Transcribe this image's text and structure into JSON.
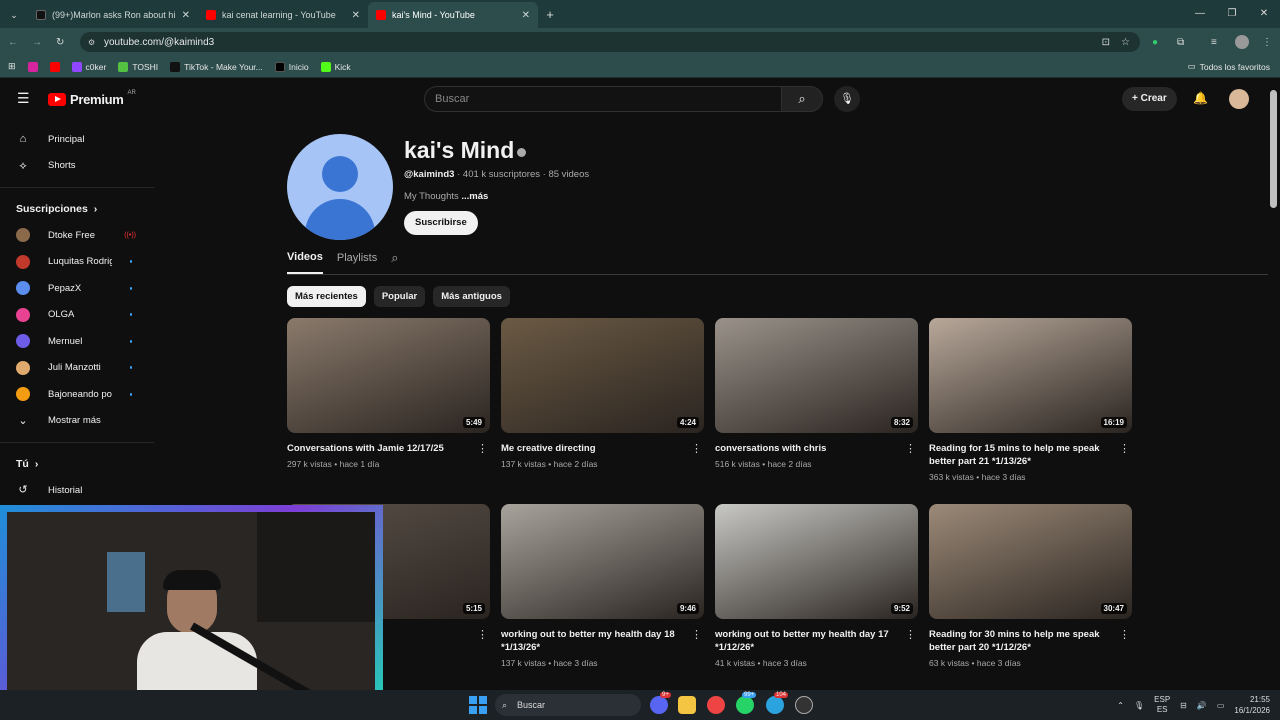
{
  "browser": {
    "tabs": [
      {
        "label": "(99+)Marlon asks Ron about hi",
        "active": false
      },
      {
        "label": "kai cenat learning - YouTube",
        "active": false
      },
      {
        "label": "kai's Mind - YouTube",
        "active": true
      }
    ],
    "url": "youtube.com/@kaimind3",
    "bookmarks": [
      "c0ker",
      "TOSHI",
      "TikTok - Make Your...",
      "Inicio",
      "Kick"
    ],
    "bookmarks_folder": "Todos los favoritos"
  },
  "youtube": {
    "logo_text": "Premium",
    "logo_region": "AR",
    "search_placeholder": "Buscar",
    "create_label": "Crear",
    "sidebar": {
      "main": [
        {
          "label": "Principal",
          "icon": "home-icon"
        },
        {
          "label": "Shorts",
          "icon": "shorts-icon"
        }
      ],
      "subscriptions_title": "Suscripciones",
      "subscriptions": [
        {
          "label": "Dtoke Free",
          "color": "#8a6a4a",
          "live": true
        },
        {
          "label": "Luquitas Rodrigu...",
          "color": "#c0392b",
          "live": false
        },
        {
          "label": "PepazX",
          "color": "#5b8def",
          "live": false
        },
        {
          "label": "OLGA",
          "color": "#e84393",
          "live": false
        },
        {
          "label": "Mernuel",
          "color": "#6c5ce7",
          "live": false
        },
        {
          "label": "Juli Manzotti",
          "color": "#e0a96d",
          "live": false
        },
        {
          "label": "Bajoneando por ...",
          "color": "#f39c12",
          "live": false
        }
      ],
      "show_more": "Mostrar más",
      "you_title": "Tú",
      "history": "Historial"
    },
    "channel": {
      "name": "kai's Mind",
      "handle": "@kaimind3",
      "subscribers": "401 k suscriptores",
      "videos_count": "85 videos",
      "description": "My Thoughts",
      "more": "...más",
      "subscribe_label": "Suscribirse",
      "tabs": [
        "Videos",
        "Playlists"
      ],
      "chips": [
        "Más recientes",
        "Popular",
        "Más antiguos"
      ]
    },
    "videos": [
      {
        "title": "Conversations with Jamie 12/17/25",
        "views": "297 k vistas",
        "age": "hace 1 día",
        "duration": "5:49",
        "color": "#8a7a6c"
      },
      {
        "title": "Me creative directing",
        "views": "137 k vistas",
        "age": "hace 2 días",
        "duration": "4:24",
        "color": "#6b5a44"
      },
      {
        "title": "conversations with chris",
        "views": "516 k vistas",
        "age": "hace 2 días",
        "duration": "8:32",
        "color": "#9a928a"
      },
      {
        "title": "Reading for 15 mins to help me speak better part 21 *1/13/26*",
        "views": "363 k vistas",
        "age": "hace 3 días",
        "duration": "16:19",
        "color": "#b8a89a"
      },
      {
        "title": "art 16 *1/11/26*",
        "views": "",
        "age": "",
        "duration": "5:15",
        "color": "#5a5048"
      },
      {
        "title": "working out to better my health day 18 *1/13/26*",
        "views": "137 k vistas",
        "age": "hace 3 días",
        "duration": "9:46",
        "color": "#a8a49c"
      },
      {
        "title": "working out to better my health day 17 *1/12/26*",
        "views": "41 k vistas",
        "age": "hace 3 días",
        "duration": "9:52",
        "color": "#c8c8c4"
      },
      {
        "title": "Reading for 30 mins to help me speak better part 20 *1/12/26*",
        "views": "63 k vistas",
        "age": "hace 3 días",
        "duration": "30:47",
        "color": "#9c8a78"
      }
    ]
  },
  "taskbar": {
    "search_placeholder": "Buscar",
    "lang_line1": "ESP",
    "lang_line2": "ES",
    "time": "21:55",
    "date": "16/1/2026",
    "badges": [
      "9+",
      "99+",
      "104"
    ]
  }
}
